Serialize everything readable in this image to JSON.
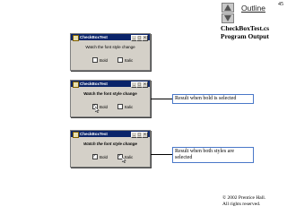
{
  "page_number": "45",
  "nav": {
    "outline_label": "Outline",
    "up_icon": "triangle-up-icon",
    "down_icon": "triangle-down-icon"
  },
  "slide_title": {
    "line1": "CheckBoxTest.cs",
    "line2": "Program Output"
  },
  "windows": [
    {
      "title": "CheckBoxTest",
      "sample_text": "Watch the font style change",
      "bold_label": "Bold",
      "italic_label": "Italic"
    },
    {
      "title": "CheckBoxTest",
      "sample_text": "Watch the font style change",
      "bold_label": "Bold",
      "italic_label": "Italic"
    },
    {
      "title": "CheckBoxTest",
      "sample_text": "Watch the font style change",
      "bold_label": "Bold",
      "italic_label": "Italic"
    }
  ],
  "callouts": {
    "bold_selected": "Result when bold is selected",
    "both_line1": "Result when both styles are",
    "both_line2": "selected"
  },
  "copyright": {
    "line1": "© 2002 Prentice Hall.",
    "line2": "All rights reserved."
  },
  "colors": {
    "titlebar": "#0a246a",
    "window_face": "#d4d0c8",
    "callout_border": "#4a78c8"
  }
}
